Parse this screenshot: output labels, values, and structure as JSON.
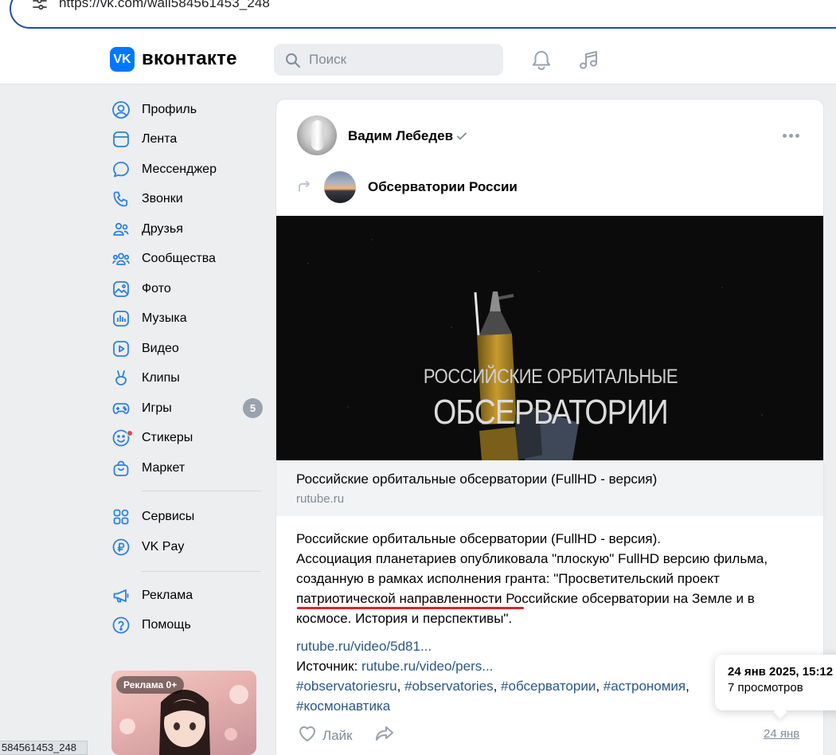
{
  "browser": {
    "url": "https://vk.com/wall584561453_248",
    "status_url": "584561453_248"
  },
  "header": {
    "logo_mark": "VK",
    "logo_text": "вконтакте",
    "search_placeholder": "Поиск",
    "icons": [
      "bell-icon",
      "music-icon"
    ]
  },
  "sidebar": {
    "items": [
      {
        "label": "Профиль",
        "icon": "profile-icon"
      },
      {
        "label": "Лента",
        "icon": "feed-icon"
      },
      {
        "label": "Мессенджер",
        "icon": "messenger-icon"
      },
      {
        "label": "Звонки",
        "icon": "phone-icon"
      },
      {
        "label": "Друзья",
        "icon": "friends-icon"
      },
      {
        "label": "Сообщества",
        "icon": "communities-icon"
      },
      {
        "label": "Фото",
        "icon": "photo-icon"
      },
      {
        "label": "Музыка",
        "icon": "music-icon"
      },
      {
        "label": "Видео",
        "icon": "video-icon"
      },
      {
        "label": "Клипы",
        "icon": "clips-icon"
      },
      {
        "label": "Игры",
        "icon": "games-icon",
        "badge": "5"
      },
      {
        "label": "Стикеры",
        "icon": "stickers-icon"
      },
      {
        "label": "Маркет",
        "icon": "market-icon"
      },
      {
        "label": "Сервисы",
        "icon": "services-icon"
      },
      {
        "label": "VK Pay",
        "icon": "vkpay-icon"
      },
      {
        "label": "Реклама",
        "icon": "ads-icon"
      },
      {
        "label": "Помощь",
        "icon": "help-icon"
      }
    ],
    "ad_label": "Реклама 0+"
  },
  "post": {
    "author": "Вадим Лебедев",
    "repost_group": "Обсерватории России",
    "video": {
      "title_line1": "РОССИЙСКИЕ ОРБИТАЛЬНЫЕ",
      "title_line2": "ОБСЕРВАТОРИИ"
    },
    "link": {
      "title": "Российские орбитальные обсерватории (FullHD - версия)",
      "domain": "rutube.ru"
    },
    "text_lines": [
      "Российские орбитальные обсерватории (FullHD - версия).",
      "Ассоциация планетариев опубликовала \"плоскую\" FullHD версию фильма,",
      "созданную в рамках исполнения гранта: \"Просветительский проект",
      "патриотической направленности Российские обсерватории на Земле и в",
      "космосе. История и перспективы\"."
    ],
    "video_link": "rutube.ru/video/5d81...",
    "source_label": "Источник:",
    "source_link": "rutube.ru/video/pers...",
    "hashtags": [
      "#observatoriesru",
      "#observatories",
      "#обсерватории",
      "#астрономия",
      "#космонавтика"
    ],
    "like_label": "Лайк",
    "date_short": "24 янв",
    "tooltip": {
      "date_full": "24 янв 2025, 15:12",
      "views": "7 просмотров"
    }
  },
  "colors": {
    "vk_blue": "#0077ff",
    "link": "#2a5885",
    "muted": "#818c99",
    "highlight_underline": "#d9232e",
    "badge": "#99a2ad"
  }
}
